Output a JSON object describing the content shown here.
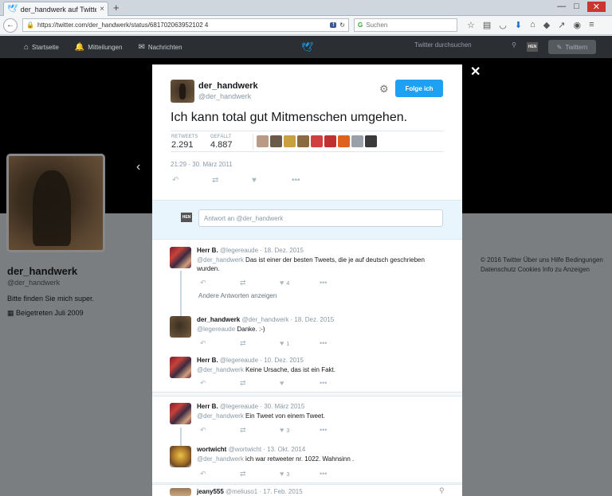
{
  "browser": {
    "tab_title": "der_handwerk auf Twitter ...",
    "tab_close": "×",
    "new_tab": "+",
    "url": "https://twitter.com/der_handwerk/status/681702063952102 4",
    "search_placeholder": "Suchen",
    "search_engine": "G",
    "back": "←",
    "reload": "↻",
    "win_min": "—",
    "win_max": "□",
    "win_close": "✕"
  },
  "twitter_nav": {
    "home": "Startseite",
    "notifications": "Mitteilungen",
    "messages": "Nachrichten",
    "search_placeholder": "Twitter durchsuchen",
    "avatar_badge": "HEN",
    "tweet_button": "Twittern"
  },
  "profile": {
    "name": "der_handwerk",
    "handle": "@der_handwerk",
    "bio": "Bitte finden Sie mich super.",
    "joined": "Beigetreten Juli 2009",
    "footer_lines": [
      "© 2016 Twitter  Über uns  Hilfe  Bedingungen",
      "Datenschutz  Cookies  Info zu Anzeigen"
    ]
  },
  "tweet": {
    "name": "der_handwerk",
    "handle": "@der_handwerk",
    "follow_label": "Folge ich",
    "text": "Ich kann total gut Mitmenschen umgehen.",
    "retweets_label": "RETWEETS",
    "retweets_value": "2.291",
    "likes_label": "GEFÄLLT",
    "likes_value": "4.887",
    "date": "21:29 - 30. März 2011",
    "liker_colors": [
      "#b89a86",
      "#6a5a4a",
      "#c9a040",
      "#8a6a40",
      "#d04040",
      "#c03030",
      "#e06020",
      "#9aa0a8",
      "#3a3a3a"
    ]
  },
  "reply_box": {
    "avatar_badge": "HEN",
    "placeholder": "Antwort an @der_handwerk"
  },
  "replies": [
    {
      "name": "Herr B.",
      "meta": "@legereaude · 18. Dez. 2015",
      "mention": "@der_handwerk",
      "text": " Das ist einer der besten Tweets, die je auf deutsch geschrieben wurden.",
      "like_count": "4"
    },
    {
      "name": "der_handwerk",
      "meta": "@der_handwerk · 18. Dez. 2015",
      "mention": "@legereaude",
      "text": " Danke. :-)",
      "like_count": "1"
    },
    {
      "name": "Herr B.",
      "meta": "@legereaude · 10. Dez. 2015",
      "mention": "@der_handwerk",
      "text": " Keine Ursache, das ist ein Fakt.",
      "like_count": ""
    },
    {
      "name": "Herr B.",
      "meta": "@legereaude · 30. März 2015",
      "mention": "@der_handwerk",
      "text": " Ein Tweet von einem Tweet.",
      "like_count": "3"
    },
    {
      "name": "wortwicht",
      "meta": "@wortwicht · 13. Okt. 2014",
      "mention": "@der_handwerk",
      "text": " ich war retweeter nr. 1022. Wahnsinn .",
      "like_count": "3"
    },
    {
      "name": "jeany555",
      "meta": "@meliuso1 · 17. Feb. 2015",
      "mention": "",
      "text": "",
      "like_count": ""
    }
  ],
  "other_answers": "Andere Antworten anzeigen"
}
